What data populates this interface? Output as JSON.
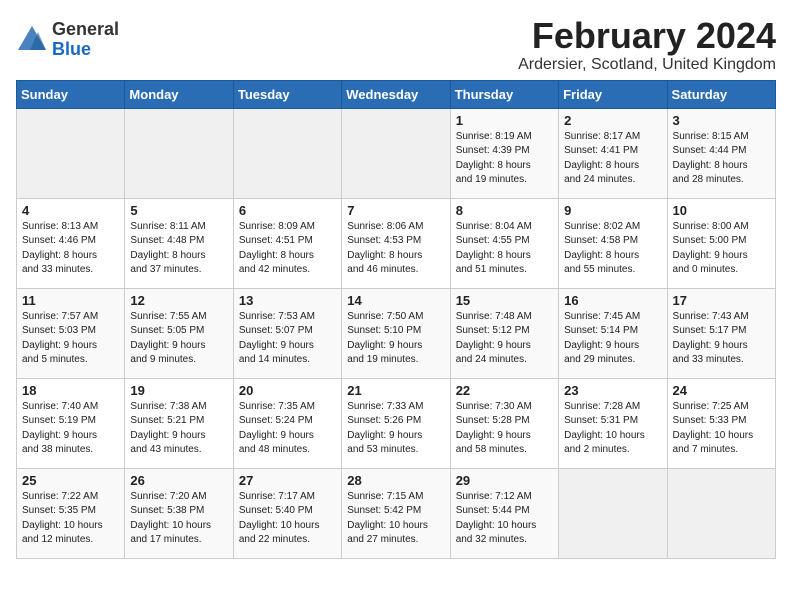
{
  "logo": {
    "general": "General",
    "blue": "Blue"
  },
  "title": "February 2024",
  "subtitle": "Ardersier, Scotland, United Kingdom",
  "days_of_week": [
    "Sunday",
    "Monday",
    "Tuesday",
    "Wednesday",
    "Thursday",
    "Friday",
    "Saturday"
  ],
  "weeks": [
    [
      {
        "day": "",
        "info": ""
      },
      {
        "day": "",
        "info": ""
      },
      {
        "day": "",
        "info": ""
      },
      {
        "day": "",
        "info": ""
      },
      {
        "day": "1",
        "info": "Sunrise: 8:19 AM\nSunset: 4:39 PM\nDaylight: 8 hours\nand 19 minutes."
      },
      {
        "day": "2",
        "info": "Sunrise: 8:17 AM\nSunset: 4:41 PM\nDaylight: 8 hours\nand 24 minutes."
      },
      {
        "day": "3",
        "info": "Sunrise: 8:15 AM\nSunset: 4:44 PM\nDaylight: 8 hours\nand 28 minutes."
      }
    ],
    [
      {
        "day": "4",
        "info": "Sunrise: 8:13 AM\nSunset: 4:46 PM\nDaylight: 8 hours\nand 33 minutes."
      },
      {
        "day": "5",
        "info": "Sunrise: 8:11 AM\nSunset: 4:48 PM\nDaylight: 8 hours\nand 37 minutes."
      },
      {
        "day": "6",
        "info": "Sunrise: 8:09 AM\nSunset: 4:51 PM\nDaylight: 8 hours\nand 42 minutes."
      },
      {
        "day": "7",
        "info": "Sunrise: 8:06 AM\nSunset: 4:53 PM\nDaylight: 8 hours\nand 46 minutes."
      },
      {
        "day": "8",
        "info": "Sunrise: 8:04 AM\nSunset: 4:55 PM\nDaylight: 8 hours\nand 51 minutes."
      },
      {
        "day": "9",
        "info": "Sunrise: 8:02 AM\nSunset: 4:58 PM\nDaylight: 8 hours\nand 55 minutes."
      },
      {
        "day": "10",
        "info": "Sunrise: 8:00 AM\nSunset: 5:00 PM\nDaylight: 9 hours\nand 0 minutes."
      }
    ],
    [
      {
        "day": "11",
        "info": "Sunrise: 7:57 AM\nSunset: 5:03 PM\nDaylight: 9 hours\nand 5 minutes."
      },
      {
        "day": "12",
        "info": "Sunrise: 7:55 AM\nSunset: 5:05 PM\nDaylight: 9 hours\nand 9 minutes."
      },
      {
        "day": "13",
        "info": "Sunrise: 7:53 AM\nSunset: 5:07 PM\nDaylight: 9 hours\nand 14 minutes."
      },
      {
        "day": "14",
        "info": "Sunrise: 7:50 AM\nSunset: 5:10 PM\nDaylight: 9 hours\nand 19 minutes."
      },
      {
        "day": "15",
        "info": "Sunrise: 7:48 AM\nSunset: 5:12 PM\nDaylight: 9 hours\nand 24 minutes."
      },
      {
        "day": "16",
        "info": "Sunrise: 7:45 AM\nSunset: 5:14 PM\nDaylight: 9 hours\nand 29 minutes."
      },
      {
        "day": "17",
        "info": "Sunrise: 7:43 AM\nSunset: 5:17 PM\nDaylight: 9 hours\nand 33 minutes."
      }
    ],
    [
      {
        "day": "18",
        "info": "Sunrise: 7:40 AM\nSunset: 5:19 PM\nDaylight: 9 hours\nand 38 minutes."
      },
      {
        "day": "19",
        "info": "Sunrise: 7:38 AM\nSunset: 5:21 PM\nDaylight: 9 hours\nand 43 minutes."
      },
      {
        "day": "20",
        "info": "Sunrise: 7:35 AM\nSunset: 5:24 PM\nDaylight: 9 hours\nand 48 minutes."
      },
      {
        "day": "21",
        "info": "Sunrise: 7:33 AM\nSunset: 5:26 PM\nDaylight: 9 hours\nand 53 minutes."
      },
      {
        "day": "22",
        "info": "Sunrise: 7:30 AM\nSunset: 5:28 PM\nDaylight: 9 hours\nand 58 minutes."
      },
      {
        "day": "23",
        "info": "Sunrise: 7:28 AM\nSunset: 5:31 PM\nDaylight: 10 hours\nand 2 minutes."
      },
      {
        "day": "24",
        "info": "Sunrise: 7:25 AM\nSunset: 5:33 PM\nDaylight: 10 hours\nand 7 minutes."
      }
    ],
    [
      {
        "day": "25",
        "info": "Sunrise: 7:22 AM\nSunset: 5:35 PM\nDaylight: 10 hours\nand 12 minutes."
      },
      {
        "day": "26",
        "info": "Sunrise: 7:20 AM\nSunset: 5:38 PM\nDaylight: 10 hours\nand 17 minutes."
      },
      {
        "day": "27",
        "info": "Sunrise: 7:17 AM\nSunset: 5:40 PM\nDaylight: 10 hours\nand 22 minutes."
      },
      {
        "day": "28",
        "info": "Sunrise: 7:15 AM\nSunset: 5:42 PM\nDaylight: 10 hours\nand 27 minutes."
      },
      {
        "day": "29",
        "info": "Sunrise: 7:12 AM\nSunset: 5:44 PM\nDaylight: 10 hours\nand 32 minutes."
      },
      {
        "day": "",
        "info": ""
      },
      {
        "day": "",
        "info": ""
      }
    ]
  ]
}
